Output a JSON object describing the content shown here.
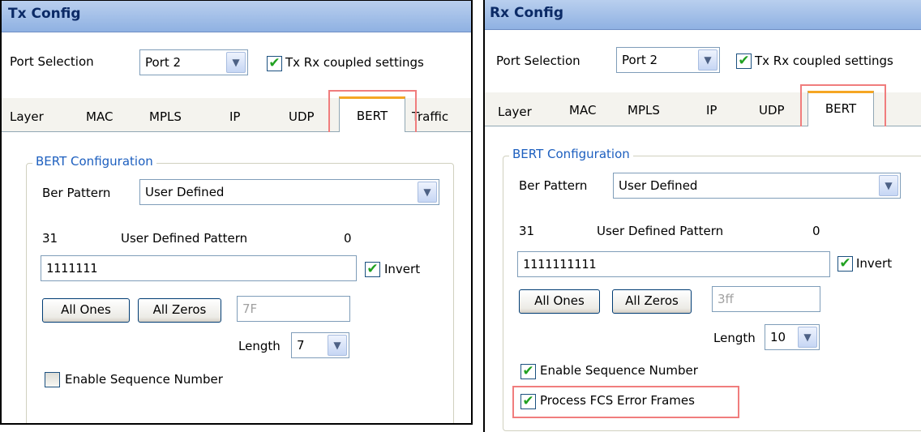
{
  "tx": {
    "title": "Tx Config",
    "port_label": "Port Selection",
    "port_value": "Port 2",
    "coupled_label": "Tx Rx coupled settings",
    "coupled_checked": true,
    "tabs": [
      "Layer",
      "MAC",
      "MPLS",
      "IP",
      "UDP",
      "BERT",
      "Traffic"
    ],
    "active_tab": "BERT",
    "group_title": "BERT Configuration",
    "ber_label": "Ber Pattern",
    "ber_value": "User Defined",
    "bit_start": "31",
    "pattern_label": "User Defined Pattern",
    "bit_end": "0",
    "pattern_value": "1111111",
    "invert_label": "Invert",
    "invert_checked": true,
    "all_ones": "All Ones",
    "all_zeros": "All Zeros",
    "hex_value": "7F",
    "length_label": "Length",
    "length_value": "7",
    "seq_label": "Enable Sequence Number",
    "seq_checked": false
  },
  "rx": {
    "title": "Rx Config",
    "port_label": "Port Selection",
    "port_value": "Port 2",
    "coupled_label": "Tx Rx coupled settings",
    "coupled_checked": true,
    "tabs": [
      "Layer",
      "MAC",
      "MPLS",
      "IP",
      "UDP",
      "BERT"
    ],
    "active_tab": "BERT",
    "group_title": "BERT Configuration",
    "ber_label": "Ber Pattern",
    "ber_value": "User Defined",
    "bit_start": "31",
    "pattern_label": "User Defined Pattern",
    "bit_end": "0",
    "pattern_value": "1111111111",
    "invert_label": "Invert",
    "invert_checked": true,
    "all_ones": "All Ones",
    "all_zeros": "All Zeros",
    "hex_value": "3ff",
    "length_label": "Length",
    "length_value": "10",
    "seq_label": "Enable Sequence Number",
    "seq_checked": true,
    "fcs_label": "Process FCS Error Frames",
    "fcs_checked": true
  },
  "icons": {
    "check": "✔",
    "dropdown": "▼"
  },
  "colors": {
    "highlight": "#f07d7d",
    "active_tab_accent": "#f5a623",
    "group_title": "#1d5fbf",
    "titlebar": "#8fb1e2"
  }
}
